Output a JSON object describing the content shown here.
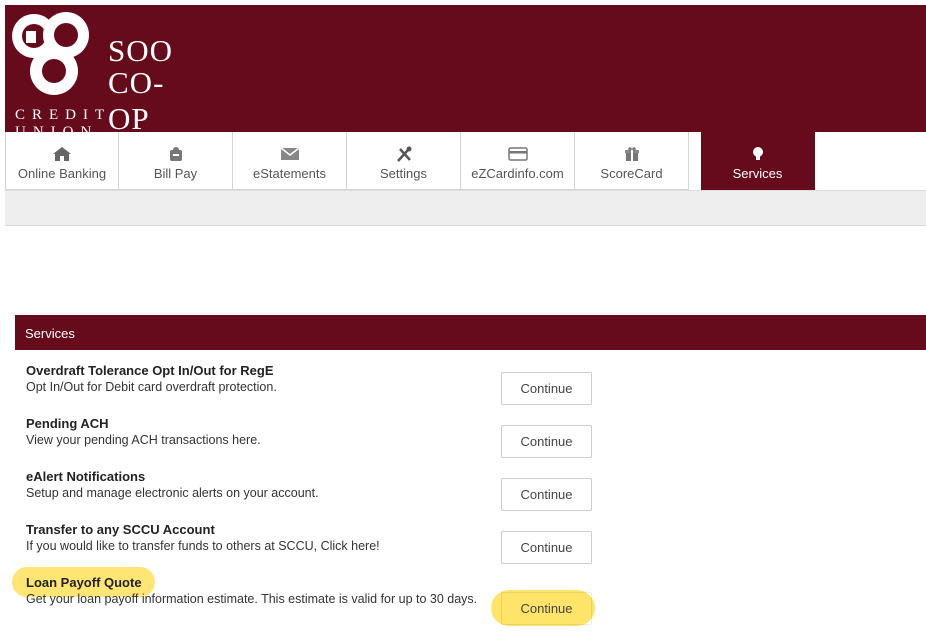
{
  "brand": {
    "line1": "SOO",
    "line2": "CO-OP",
    "line3": "CREDIT UNION",
    "color": "#650b1c"
  },
  "nav": {
    "tabs": [
      {
        "label": "Online Banking",
        "icon": "home-icon"
      },
      {
        "label": "Bill Pay",
        "icon": "bill-pay-icon"
      },
      {
        "label": "eStatements",
        "icon": "envelope-icon"
      },
      {
        "label": "Settings",
        "icon": "tools-icon"
      },
      {
        "label": "eZCardinfo.com",
        "icon": "credit-card-icon"
      },
      {
        "label": "ScoreCard",
        "icon": "gift-icon"
      },
      {
        "label": "Services",
        "icon": "lightbulb-icon",
        "active": true
      }
    ]
  },
  "panel": {
    "heading": "Services"
  },
  "services": [
    {
      "title": "Overdraft Tolerance Opt In/Out for RegE",
      "desc": "Opt In/Out for Debit card overdraft protection.",
      "button": "Continue"
    },
    {
      "title": "Pending ACH",
      "desc": "View your pending ACH transactions here.",
      "button": "Continue"
    },
    {
      "title": "eAlert Notifications",
      "desc": "Setup and manage electronic alerts on your account.",
      "button": "Continue"
    },
    {
      "title": "Transfer to any SCCU Account",
      "desc": "If you would like to transfer funds to others at SCCU, Click here!",
      "button": "Continue"
    },
    {
      "title": "Loan Payoff Quote",
      "desc": "Get your loan payoff information estimate. This estimate is valid for up to 30 days.",
      "button": "Continue"
    }
  ],
  "highlight_color": "#ffe15a"
}
